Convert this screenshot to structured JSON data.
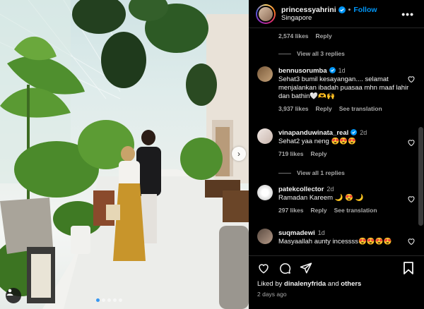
{
  "colors": {
    "accent": "#0095f6",
    "muted": "#a8a8a8",
    "background": "#000000"
  },
  "photo": {
    "carousel_dots": 5,
    "active_dot": 0
  },
  "header": {
    "username": "princessyahrini",
    "separator": "•",
    "follow_label": "Follow",
    "location": "Singapore",
    "more_label": "•••"
  },
  "comments": {
    "prev_meta": {
      "likes": "2,574 likes",
      "reply": "Reply"
    },
    "prev_view_replies": "View all 3 replies",
    "items": [
      {
        "username": "bennusorumba",
        "time": "1d",
        "text": "Sehat3 bumil kesayangan.... selamat menjalankan ibadah puasaa mhn maaf lahir dan bathin🤍🫶🙌",
        "likes": "3,937 likes",
        "reply": "Reply",
        "translate": "See translation"
      },
      {
        "username": "vinapanduwinata_real",
        "time": "2d",
        "text": "Sehat2 yaa neng 😍😍😍",
        "likes": "719 likes",
        "reply": "Reply",
        "view_replies": "View all 1 replies"
      },
      {
        "username": "patekcollector",
        "time": "2d",
        "text": "Ramadan Kareem 🌙 😍 🌙",
        "likes": "297 likes",
        "reply": "Reply",
        "translate": "See translation"
      },
      {
        "username": "suqmadewi",
        "time": "1d",
        "text": "Masyaallah aunty incessss😍😍😍😍"
      }
    ]
  },
  "footer": {
    "liked_prefix": "Liked by",
    "liked_user": "dinalenyfrida",
    "liked_and": "and",
    "liked_others": "others",
    "time_ago": "2 days ago"
  }
}
